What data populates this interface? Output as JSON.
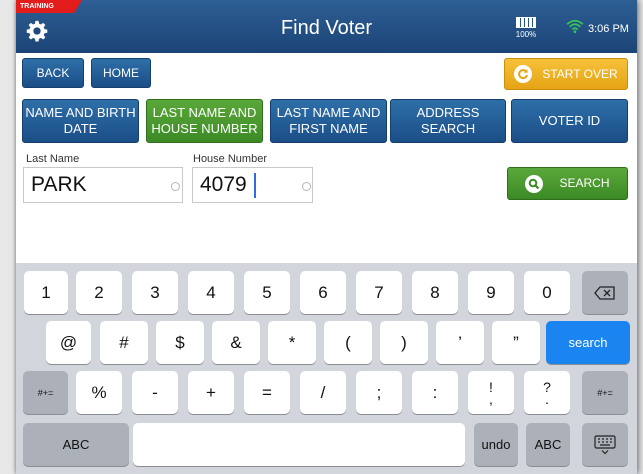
{
  "header": {
    "training_label": "TRAINING",
    "title": "Find Voter",
    "battery_pct": "100%",
    "time": "3:06 PM",
    "icons": {
      "settings": "gear-icon",
      "battery": "battery-icon",
      "wifi": "wifi-icon"
    }
  },
  "nav": {
    "back_label": "BACK",
    "home_label": "HOME",
    "start_over_label": "START OVER"
  },
  "search_modes": [
    {
      "label": "NAME AND BIRTH DATE",
      "active": false
    },
    {
      "label": "LAST NAME AND HOUSE NUMBER",
      "active": true
    },
    {
      "label": "LAST NAME AND FIRST NAME",
      "active": false
    },
    {
      "label": "ADDRESS SEARCH",
      "active": false
    },
    {
      "label": "VOTER ID",
      "active": false
    }
  ],
  "form": {
    "last_name_label": "Last Name",
    "last_name_value": "PARK",
    "house_number_label": "House Number",
    "house_number_value": "4079",
    "search_label": "SEARCH"
  },
  "keyboard": {
    "row1": [
      "1",
      "2",
      "3",
      "4",
      "5",
      "6",
      "7",
      "8",
      "9",
      "0"
    ],
    "row2": [
      "@",
      "#",
      "$",
      "&",
      "*",
      "(",
      ")",
      "’",
      "”"
    ],
    "return_label": "search",
    "row3_left": "#+=",
    "row3": [
      "%",
      "-",
      "+",
      "=",
      "/",
      ";",
      ":"
    ],
    "row3_two": [
      [
        "!",
        ","
      ],
      [
        "?",
        "."
      ]
    ],
    "row3_right": "#+=",
    "abc_left": "ABC",
    "undo": "undo",
    "abc_right": "ABC"
  },
  "colors": {
    "header": "#1c4476",
    "primary_button": "#1b4e87",
    "active_button": "#3c8a25",
    "start_over": "#e6a414",
    "keyboard_bg": "#d2d5db",
    "search_key": "#1a84f0",
    "training_tag": "#e21b1b"
  }
}
